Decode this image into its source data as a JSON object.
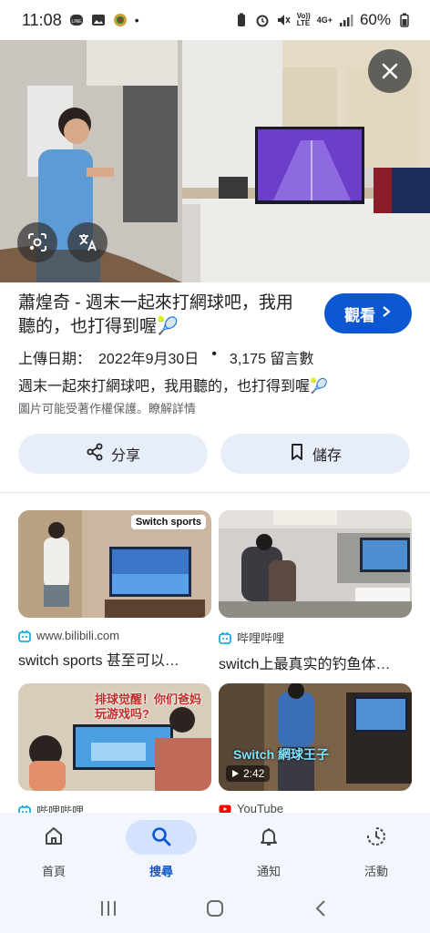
{
  "status_bar": {
    "time": "11:08",
    "battery": "60%",
    "network": "4G+"
  },
  "hero": {
    "close_icon": "close-icon",
    "lens_icon": "lens-icon",
    "translate_icon": "translate-icon"
  },
  "result": {
    "title": "蕭煌奇 - 週末一起來打網球吧，我用聽的，也打得到喔🎾",
    "watch_label": "觀看",
    "upload_label": "上傳日期：",
    "upload_date": "2022年9月30日",
    "separator": "•",
    "comments": "3,175 留言數",
    "description": "週末一起來打網球吧，我用聽的，也打得到喔🎾",
    "copyright_note": "圖片可能受著作權保護。瞭解詳情"
  },
  "actions": {
    "share_label": "分享",
    "save_label": "儲存"
  },
  "related": [
    {
      "source": "www.bilibili.com",
      "title": "switch sports 甚至可以…",
      "badge": "Switch sports"
    },
    {
      "source": "哔哩哔哩",
      "title": "switch上最真实的钓鱼体…"
    },
    {
      "source": "哔哩哔哩",
      "title": "",
      "overlay": "排球觉醒！你们爸妈玩游戏吗?"
    },
    {
      "source": "YouTube",
      "title": "",
      "duration": "2:42",
      "overlay": "Switch 網球王子"
    }
  ],
  "bottom_nav": {
    "items": [
      {
        "label": "首頁",
        "icon": "home-icon"
      },
      {
        "label": "搜尋",
        "icon": "search-icon",
        "active": true
      },
      {
        "label": "通知",
        "icon": "bell-icon"
      },
      {
        "label": "活動",
        "icon": "activity-icon"
      }
    ]
  },
  "colors": {
    "accent": "#0b57d0",
    "button_bg": "#e8eef9",
    "nav_bg": "#f3f6fc",
    "active_pill": "#d3e3fd"
  }
}
